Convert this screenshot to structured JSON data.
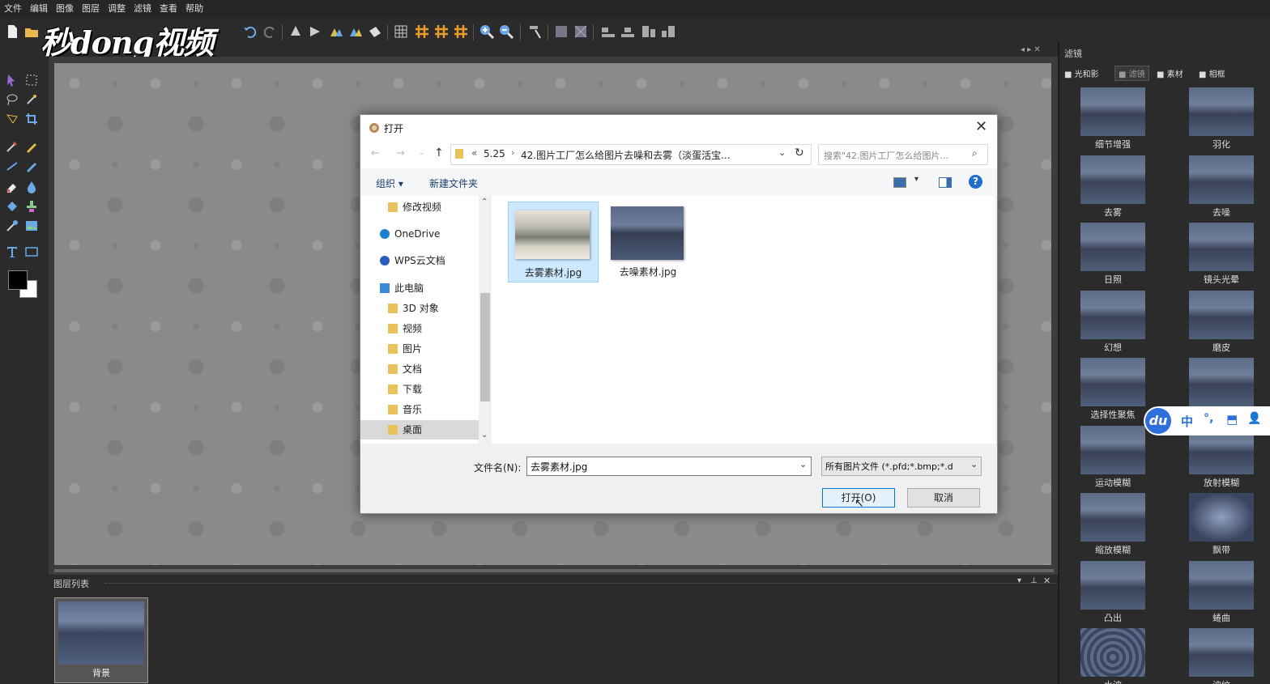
{
  "menu": [
    "文件",
    "编辑",
    "图像",
    "图层",
    "调整",
    "滤镜",
    "查看",
    "帮助"
  ],
  "watermark": "秒dong视频",
  "layers_panel": {
    "title": "图层列表",
    "layer_name": "背景"
  },
  "right_panel": {
    "title": "滤镜",
    "tabs": [
      "光和影",
      "滤镜",
      "素材",
      "相框"
    ],
    "filters": [
      "细节增强",
      "羽化",
      "去雾",
      "去噪",
      "日照",
      "镜头光晕",
      "幻想",
      "磨皮",
      "选择性聚焦",
      "",
      "运动模糊",
      "放射模糊",
      "缩放模糊",
      "飘带",
      "凸出",
      "蜷曲",
      "水波",
      "波纹"
    ]
  },
  "ime": {
    "logo": "du",
    "mode": "中",
    "punct": "°,",
    "symbols": [
      "⬒",
      "👤"
    ]
  },
  "dialog": {
    "title": "打开",
    "breadcrumb": {
      "prefix": "«",
      "segments": [
        "5.25",
        "42.图片工厂怎么给图片去噪和去雾（淡蛋活宝..."
      ]
    },
    "search_placeholder": "搜索\"42.图片工厂怎么给图片...",
    "organize": "组织 ▾",
    "new_folder": "新建文件夹",
    "nav_items": [
      {
        "label": "修改视频",
        "type": "folder"
      },
      {
        "label": "OneDrive",
        "type": "cloud"
      },
      {
        "label": "WPS云文档",
        "type": "cloud2"
      },
      {
        "label": "此电脑",
        "type": "pc"
      },
      {
        "label": "3D 对象",
        "type": "folder"
      },
      {
        "label": "视频",
        "type": "folder"
      },
      {
        "label": "图片",
        "type": "folder"
      },
      {
        "label": "文档",
        "type": "folder"
      },
      {
        "label": "下载",
        "type": "folder"
      },
      {
        "label": "音乐",
        "type": "folder"
      },
      {
        "label": "桌面",
        "type": "folder"
      }
    ],
    "files": [
      "去雾素材.jpg",
      "去噪素材.jpg"
    ],
    "filename_label": "文件名(N):",
    "filename_value": "去雾素材.jpg",
    "filetype_value": "所有图片文件 (*.pfd;*.bmp;*.d",
    "open_button": "打开(O)",
    "cancel_button": "取消"
  }
}
